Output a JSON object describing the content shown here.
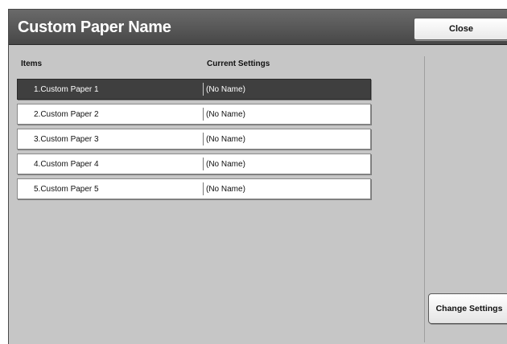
{
  "header": {
    "title": "Custom Paper Name",
    "close_label": "Close"
  },
  "columns": {
    "items": "Items",
    "current": "Current Settings"
  },
  "rows": [
    {
      "item": "1.Custom Paper 1",
      "value": "(No Name)",
      "selected": true
    },
    {
      "item": "2.Custom Paper 2",
      "value": "(No Name)",
      "selected": false
    },
    {
      "item": "3.Custom Paper 3",
      "value": "(No Name)",
      "selected": false
    },
    {
      "item": "4.Custom Paper 4",
      "value": "(No Name)",
      "selected": false
    },
    {
      "item": "5.Custom Paper 5",
      "value": "(No Name)",
      "selected": false
    }
  ],
  "actions": {
    "change_settings_label": "Change Settings"
  },
  "colors": {
    "panel": "#c6c6c6",
    "title_bar": "#474747",
    "selected_row": "#3f3f3f"
  }
}
